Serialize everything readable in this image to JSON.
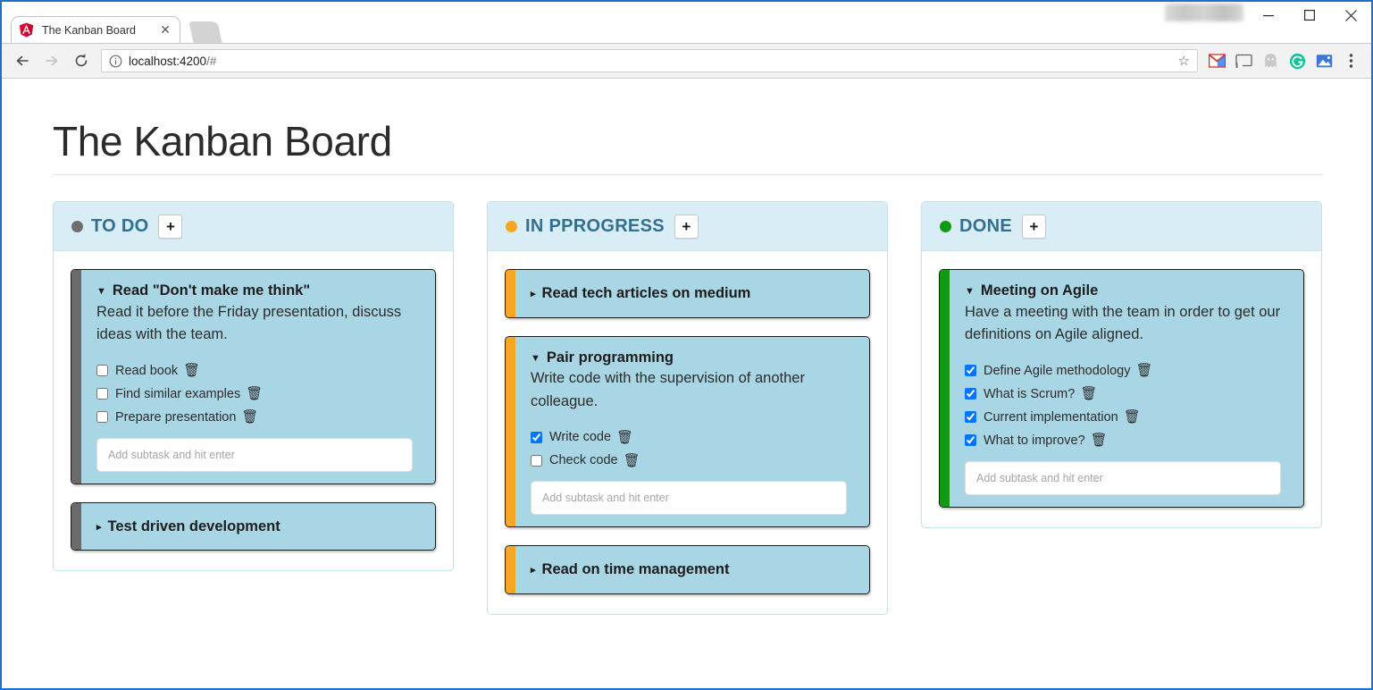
{
  "browser": {
    "tab": {
      "title": "The Kanban Board",
      "favicon": "angular-favicon",
      "close_label": "✕"
    },
    "window_controls": {
      "minimize": "—",
      "maximize": "□",
      "close": "✕"
    },
    "toolbar": {
      "back": "←",
      "forward": "→",
      "reload": "⟳",
      "url_host": "localhost:4200",
      "url_path": "/#",
      "url_full": "localhost:4200/#",
      "star": "☆",
      "extensions": [
        "gmail-icon",
        "cast-icon",
        "ghostery-icon",
        "grammarly-icon",
        "pocket-icon"
      ],
      "menu": "⋮"
    }
  },
  "page": {
    "title": "The Kanban Board"
  },
  "board": {
    "input_placeholder": "Add subtask and hit enter",
    "add_button_label": "+",
    "columns": [
      {
        "name": "todo",
        "title": "TO DO",
        "dot_color": "#6f6f6f",
        "stripe_color": "#6b6b6b",
        "cards": [
          {
            "title": "Read \"Don't make me think\"",
            "description": "Read it before the Friday presentation, discuss ideas with the team.",
            "expanded": true,
            "caret": "▼",
            "subtasks": [
              {
                "label": "Read book",
                "done": false
              },
              {
                "label": "Find similar examples",
                "done": false
              },
              {
                "label": "Prepare presentation",
                "done": false
              }
            ]
          },
          {
            "title": "Test driven development",
            "description": "",
            "expanded": false,
            "caret": "▸",
            "subtasks": []
          }
        ]
      },
      {
        "name": "in-progress",
        "title": "IN PPROGRESS",
        "dot_color": "#f5a623",
        "stripe_color": "#f5a623",
        "cards": [
          {
            "title": "Read tech articles on medium",
            "description": "",
            "expanded": false,
            "caret": "▸",
            "subtasks": []
          },
          {
            "title": "Pair programming",
            "description": "Write code with the supervision of another colleague.",
            "expanded": true,
            "caret": "▼",
            "subtasks": [
              {
                "label": "Write code",
                "done": true
              },
              {
                "label": "Check code",
                "done": false
              }
            ]
          },
          {
            "title": "Read on time management",
            "description": "",
            "expanded": false,
            "caret": "▸",
            "subtasks": []
          }
        ]
      },
      {
        "name": "done",
        "title": "DONE",
        "dot_color": "#119911",
        "stripe_color": "#119911",
        "cards": [
          {
            "title": "Meeting on Agile",
            "description": "Have a meeting with the team in order to get our definitions on Agile aligned.",
            "expanded": true,
            "caret": "▼",
            "subtasks": [
              {
                "label": "Define Agile methodology",
                "done": true
              },
              {
                "label": "What is Scrum?",
                "done": true
              },
              {
                "label": "Current implementation",
                "done": true
              },
              {
                "label": "What to improve?",
                "done": true
              }
            ]
          }
        ]
      }
    ],
    "trash_icon": "🗑"
  }
}
